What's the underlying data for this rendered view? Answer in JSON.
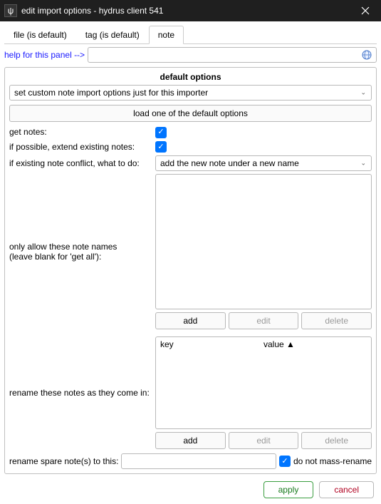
{
  "window": {
    "title": "edit import options - hydrus client 541",
    "icon_char": "ψ"
  },
  "tabs": [
    {
      "label": "file (is default)",
      "active": false
    },
    {
      "label": "tag (is default)",
      "active": false
    },
    {
      "label": "note",
      "active": true
    }
  ],
  "help": {
    "label": "help for this panel -->"
  },
  "fieldset": {
    "title": "default options",
    "mode_selected": "set custom note import options just for this importer",
    "load_button": "load one of the default options"
  },
  "rows": {
    "get_notes": {
      "label": "get notes:",
      "checked": true
    },
    "extend_existing": {
      "label": "if possible, extend existing notes:",
      "checked": true
    },
    "conflict": {
      "label": "if existing note conflict, what to do:",
      "selected": "add the new note under a new name"
    },
    "allow_names": {
      "label_line1": "only allow these note names",
      "label_line2": "(leave blank for 'get all'):"
    },
    "rename_incoming": {
      "label": "rename these notes as they come in:"
    },
    "rename_spare": {
      "label": "rename spare note(s) to this:",
      "nomass_label": "do not mass-rename",
      "nomass_checked": true
    }
  },
  "kv": {
    "col_key": "key",
    "col_value": "value ▲"
  },
  "buttons": {
    "add": "add",
    "edit": "edit",
    "delete": "delete",
    "apply": "apply",
    "cancel": "cancel"
  }
}
